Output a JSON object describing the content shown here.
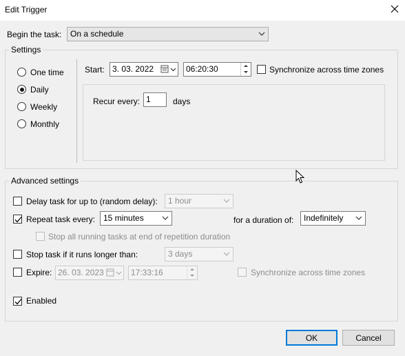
{
  "window": {
    "title": "Edit Trigger"
  },
  "begin": {
    "label": "Begin the task:",
    "value": "On a schedule"
  },
  "settings": {
    "legend": "Settings",
    "frequency": [
      {
        "label": "One time",
        "selected": false
      },
      {
        "label": "Daily",
        "selected": true
      },
      {
        "label": "Weekly",
        "selected": false
      },
      {
        "label": "Monthly",
        "selected": false
      }
    ],
    "start_label": "Start:",
    "start_date": "3. 03. 2022",
    "start_time": "06:20:30",
    "sync_label": "Synchronize across time zones",
    "recur_label": "Recur every:",
    "recur_value": "1",
    "recur_unit": "days"
  },
  "advanced": {
    "legend": "Advanced settings",
    "delay_label": "Delay task for up to (random delay):",
    "delay_value": "1 hour",
    "repeat_label": "Repeat task every:",
    "repeat_value": "15 minutes",
    "duration_label": "for a duration of:",
    "duration_value": "Indefinitely",
    "stop_running_label": "Stop all running tasks at end of repetition duration",
    "stop_longer_label": "Stop task if it runs longer than:",
    "stop_longer_value": "3 days",
    "expire_label": "Expire:",
    "expire_date": "26. 03. 2023",
    "expire_time": "17:33:16",
    "expire_sync_label": "Synchronize across time zones",
    "enabled_label": "Enabled"
  },
  "buttons": {
    "ok": "OK",
    "cancel": "Cancel"
  },
  "colors": {
    "accent": "#0078d7",
    "window_bg": "#f0f0f0"
  }
}
